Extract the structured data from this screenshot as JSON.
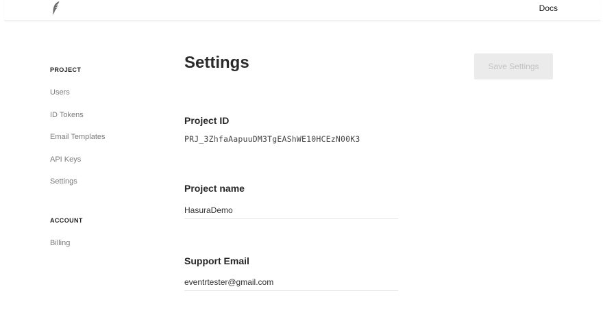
{
  "header": {
    "logo_icon": "feather-icon",
    "docs_label": "Docs"
  },
  "sidebar": {
    "project_section": "PROJECT",
    "project_items": [
      {
        "label": "Users"
      },
      {
        "label": "ID Tokens"
      },
      {
        "label": "Email Templates"
      },
      {
        "label": "API Keys"
      },
      {
        "label": "Settings"
      }
    ],
    "account_section": "ACCOUNT",
    "account_items": [
      {
        "label": "Billing"
      }
    ]
  },
  "main": {
    "title": "Settings",
    "save_label": "Save Settings",
    "project_id_label": "Project ID",
    "project_id_value": "PRJ_3ZhfaAapuuDM3TgEAShWE10HCEzN00K3",
    "project_name_label": "Project name",
    "project_name_value": "HasuraDemo",
    "support_email_label": "Support Email",
    "support_email_value": "eventrtester@gmail.com"
  },
  "colors": {
    "save_button_bg": "#ebebeb",
    "save_button_text": "#c2c2c2",
    "nav_text": "#7a7a7a"
  }
}
